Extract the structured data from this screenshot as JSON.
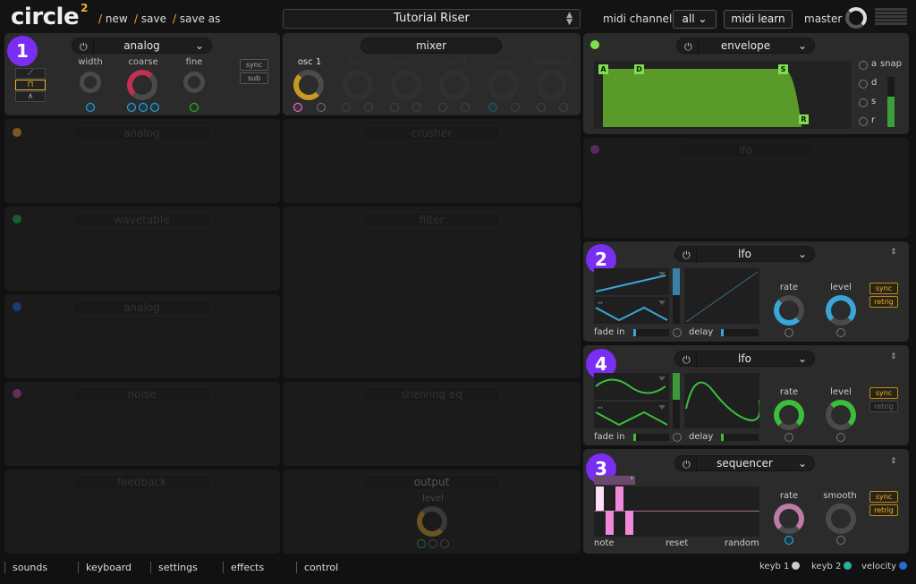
{
  "header": {
    "logo": "circle",
    "logo_sup": "2",
    "new_label": "new",
    "save_label": "save",
    "save_as_label": "save as",
    "preset_name": "Tutorial Riser",
    "midi_channel_label": "midi channel",
    "midi_channel_value": "all",
    "midi_learn_label": "midi learn",
    "master_label": "master"
  },
  "osc_panel": {
    "badge": "1",
    "type": "analog",
    "knobs": [
      "width",
      "coarse",
      "fine"
    ],
    "sync_label": "sync",
    "sub_label": "sub"
  },
  "mixer": {
    "title": "mixer",
    "channels": [
      "osc 1",
      "osc 2",
      "osc 3",
      "osc 4",
      "noise",
      "feedback"
    ]
  },
  "envelope": {
    "title": "envelope",
    "points": [
      "A",
      "D",
      "S",
      "R"
    ],
    "options": [
      "a",
      "d",
      "s",
      "r"
    ],
    "snap_label": "snap"
  },
  "dim_left": {
    "slot2": "analog",
    "slot3": "wavetable",
    "slot4": "analog",
    "slot5": "noise",
    "slot6": "feedback"
  },
  "dim_mid": {
    "crusher": "crusher",
    "filter": "filter",
    "shelving": "shelving eq",
    "output": "output",
    "level": "level"
  },
  "dim_right": {
    "lfo": "lfo"
  },
  "lfo_a": {
    "badge": "2",
    "title": "lfo",
    "fade_in": "fade in",
    "delay": "delay",
    "rate": "rate",
    "level": "level",
    "sync": "sync",
    "retrig": "retrig",
    "color": "#3aa6d8"
  },
  "lfo_b": {
    "badge": "4",
    "title": "lfo",
    "fade_in": "fade in",
    "delay": "delay",
    "rate": "rate",
    "level": "level",
    "sync": "sync",
    "retrig": "retrig",
    "color": "#3bbf3b"
  },
  "sequencer": {
    "badge": "3",
    "title": "sequencer",
    "note": "note",
    "reset": "reset",
    "random": "random",
    "rate": "rate",
    "smooth": "smooth",
    "sync": "sync",
    "retrig": "retrig",
    "color": "#f08ad8"
  },
  "footer": {
    "tabs": [
      "sounds",
      "keyboard",
      "settings",
      "effects",
      "control"
    ],
    "keyb1": "keyb 1",
    "keyb2": "keyb 2",
    "velocity": "velocity"
  },
  "colors": {
    "accent": "#f0b030",
    "badge": "#7a2ef2",
    "envelope": "#5a9a2a",
    "lfo_blue": "#3aa6d8",
    "lfo_green": "#3bbf3b",
    "seq_pink": "#f08ad8"
  }
}
